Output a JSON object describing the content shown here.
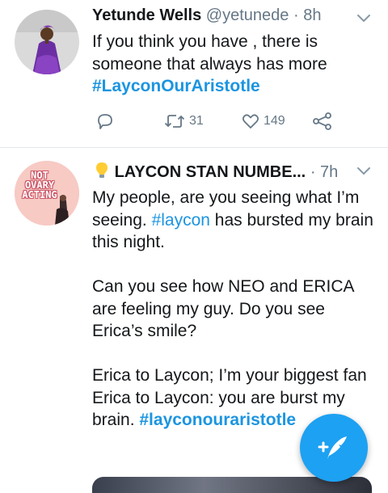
{
  "tweets": [
    {
      "name": "Yetunde Wells",
      "handle": "@yetunede",
      "separator": "·",
      "time": "8h",
      "text_plain": "If you think you have , there is someone that always has more",
      "hashtag": "#LayconOurAristotle",
      "retweets": "31",
      "likes": "149"
    },
    {
      "emoji": "bulb",
      "name": "LAYCON STAN NUMBE...",
      "separator": "·",
      "time": "7h",
      "avatar_text": [
        "NOT",
        "OVARY",
        "ACTING"
      ],
      "p1_before": "My people, are you seeing what I’m seeing. ",
      "p1_tag": "#laycon",
      "p1_after": " has bursted my brain this night.",
      "p2": "Can you see how NEO and ERICA are feeling my guy. Do you see Erica’s smile?",
      "p3a": "Erica to Laycon; I’m your biggest fan",
      "p3b": "Erica to Laycon: you are burst my brain. ",
      "p3_tag": "#layconouraristotle"
    }
  ],
  "colors": {
    "link": "#1b95e0",
    "fab": "#1da1f2",
    "muted": "#657786"
  },
  "icons": [
    "reply-icon",
    "retweet-icon",
    "like-icon",
    "share-icon",
    "chevron-down-icon",
    "compose-icon",
    "lightbulb-icon"
  ]
}
